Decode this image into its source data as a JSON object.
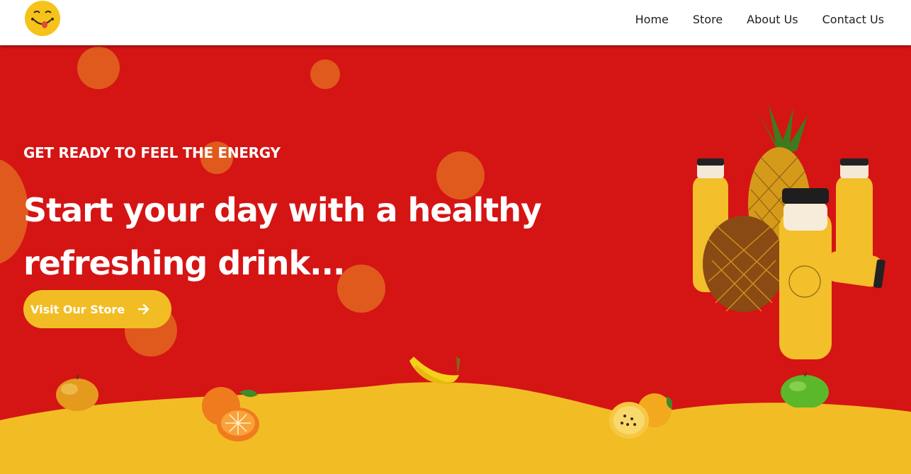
{
  "nav": {
    "logo": "smiley-logo",
    "links": [
      "Home",
      "Store",
      "About Us",
      "Contact Us"
    ]
  },
  "hero": {
    "eyebrow": "GET READY TO FEEL THE ENERGY",
    "headline_line1": "Start your day with a healthy",
    "headline_line2": "refreshing drink...",
    "cta_label": "Visit Our Store",
    "cta_icon": "arrow-right-icon"
  },
  "colors": {
    "hero_bg": "#d51414",
    "accent_yellow": "#f2bd24",
    "bubble": "#e05a1e",
    "nav_bg": "#ffffff"
  },
  "images": [
    "juice-bottles-and-pineapples",
    "mango",
    "oranges",
    "bananas",
    "passion-fruit",
    "green-apple"
  ]
}
